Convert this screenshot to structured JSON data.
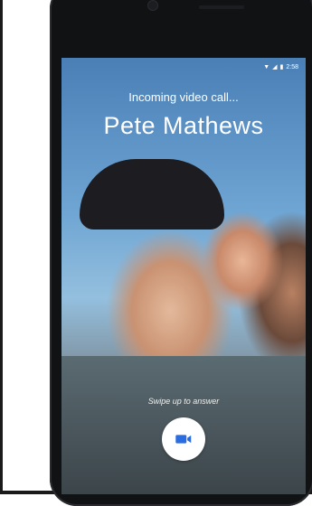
{
  "status_bar": {
    "time": "2:58",
    "icons": [
      "wifi-icon",
      "signal-icon",
      "battery-icon"
    ]
  },
  "call": {
    "label": "Incoming video call...",
    "caller_name": "Pete Mathews",
    "swipe_hint": "Swipe up to answer",
    "answer_icon": "video-camera-icon"
  },
  "colors": {
    "phone_body": "#111214",
    "answer_icon": "#2b6de0",
    "text": "#ffffff"
  }
}
